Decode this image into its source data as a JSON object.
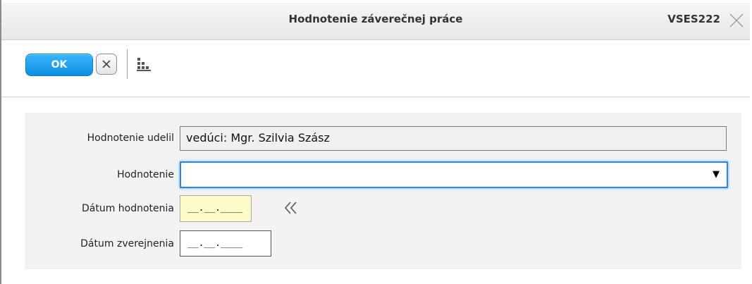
{
  "window": {
    "title": "Hodnotenie záverečnej práce",
    "app_code": "VSES222",
    "close_icon": "close-icon"
  },
  "toolbar": {
    "ok_label": "OK",
    "cancel_icon": "close-icon",
    "tree_icon": "tree-hierarchy-icon"
  },
  "form": {
    "fields": {
      "evaluator": {
        "label": "Hodnotenie udelil",
        "value": "vedúci: Mgr. Szilvia Szász"
      },
      "evaluation": {
        "label": "Hodnotenie",
        "value": ""
      },
      "evaluation_date": {
        "label": "Dátum hodnotenia",
        "value": "__.__.____"
      },
      "publication_date": {
        "label": "Dátum zverejnenia",
        "value": "__.__.____"
      }
    },
    "fill_date_icon": "double-chevron-left-icon"
  },
  "colors": {
    "accent": "#1a9cf0",
    "focus_border": "#2b86e6",
    "required_field_bg": "#fefcc9",
    "panel_bg": "#f3f3f3"
  }
}
